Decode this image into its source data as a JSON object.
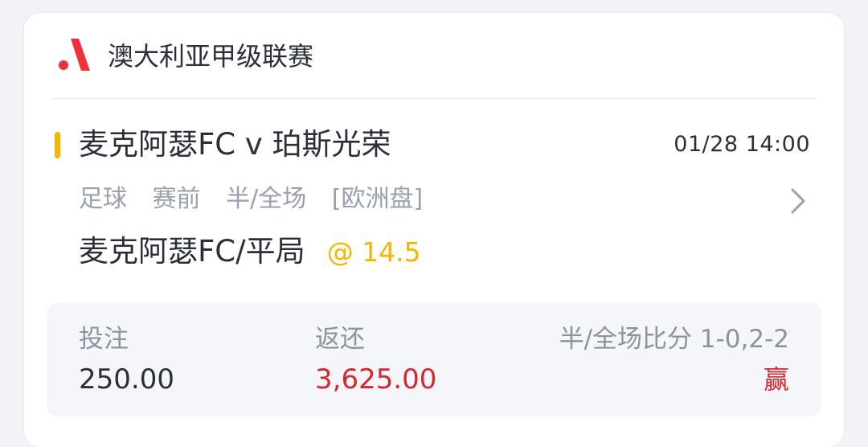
{
  "league": {
    "name": "澳大利亚甲级联赛",
    "logo_icon": "league-logo-icon"
  },
  "match": {
    "title": "麦克阿瑟FC v 珀斯光荣",
    "time": "01/28 14:00",
    "tags": [
      "足球",
      "赛前",
      "半/全场",
      "[欧洲盘]"
    ],
    "indicator_color": "#f7b500"
  },
  "selection": {
    "name": "麦克阿瑟FC/平局",
    "odds": "@ 14.5"
  },
  "summary": {
    "stake_label": "投注",
    "stake_value": "250.00",
    "return_label": "返还",
    "return_value": "3,625.00",
    "score_label": "半/全场比分 1-0,2-2",
    "result": "赢"
  },
  "colors": {
    "accent_yellow": "#f7b500",
    "win_red": "#d9262c",
    "logo_red": "#f0313a"
  }
}
